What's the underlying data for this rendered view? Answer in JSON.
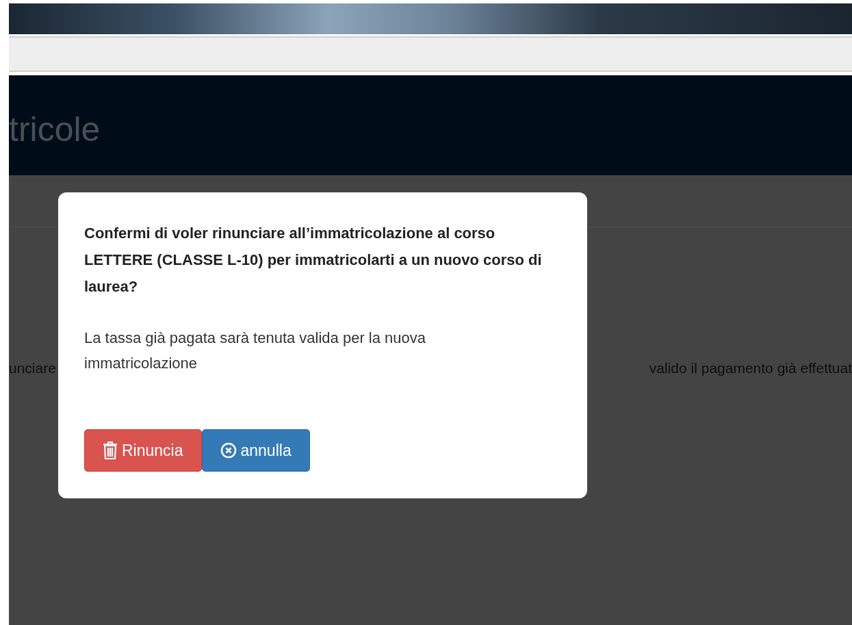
{
  "header": {
    "title": "tricole"
  },
  "background_text": {
    "left": "unciare",
    "right": "valido il pagamento già effettuat"
  },
  "dialog": {
    "question": "Confermi di voler rinunciare all’immatricolazione al corso LETTERE (CLASSE L-10) per immatricolarti a un nuovo corso di laurea?",
    "message": "La tassa già pagata sarà tenuta valida per la nuova immatricolazione",
    "buttons": [
      {
        "kind": "danger",
        "label": "Rinuncia"
      },
      {
        "kind": "primary",
        "label": "annulla"
      }
    ]
  }
}
